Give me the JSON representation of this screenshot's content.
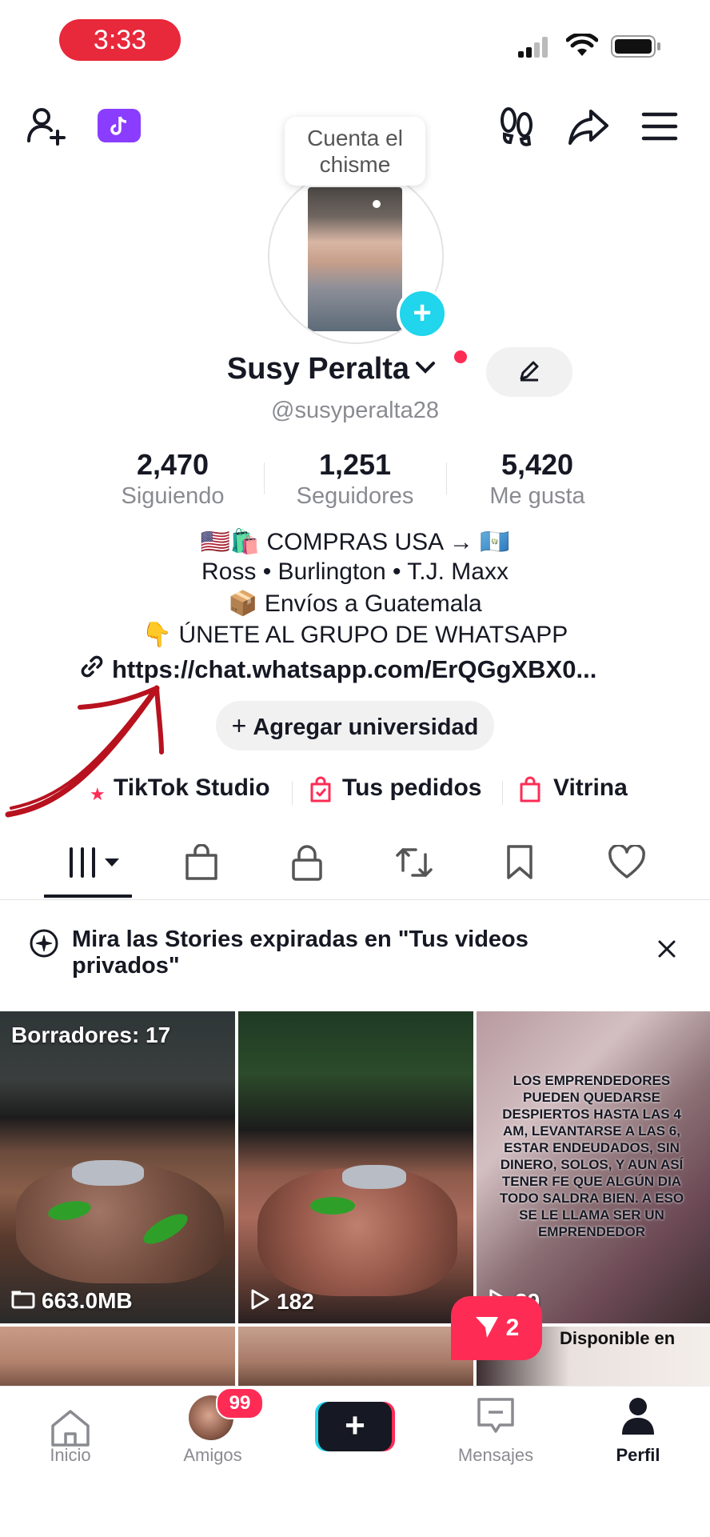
{
  "status_bar": {
    "time": "3:33"
  },
  "tooltip": {
    "text": "Cuenta el chisme"
  },
  "profile": {
    "name": "Susy Peralta",
    "handle": "@susyperalta28",
    "stats": [
      {
        "value": "2,470",
        "label": "Siguiendo"
      },
      {
        "value": "1,251",
        "label": "Seguidores"
      },
      {
        "value": "5,420",
        "label": "Me gusta"
      }
    ],
    "bio": [
      "🇺🇸🛍️ COMPRAS USA → 🇬🇹",
      "Ross • Burlington • T.J. Maxx",
      "📦 Envíos a Guatemala",
      "👇 ÚNETE AL GRUPO DE WHATSAPP"
    ],
    "link": "https://chat.whatsapp.com/ErQGgXBX0...",
    "add_university": "Agregar universidad"
  },
  "quick_links": [
    {
      "label": "TikTok Studio"
    },
    {
      "label": "Tus pedidos"
    },
    {
      "label": "Vitrina"
    }
  ],
  "notice": {
    "text": "Mira las Stories expiradas en \"Tus videos privados\""
  },
  "grid": {
    "drafts_label": "Borradores: 17",
    "drafts_size": "663.0MB",
    "video2_views": "182",
    "video3_overlay": "LOS EMPRENDEDORES PUEDEN QUEDARSE DESPIERTOS HASTA LAS 4 AM, LEVANTARSE A LAS 6, ESTAR ENDEUDADOS, SIN DINERO, SOLOS, Y AUN ASÍ TENER FE QUE ALGÚN DIA TODO SALDRA BIEN. A ESO SE LE LLAMA SER UN EMPRENDEDOR",
    "video3_views": "29",
    "available_text": "Disponible en",
    "share_count": "2"
  },
  "bottom_nav": {
    "items": [
      {
        "label": "Inicio"
      },
      {
        "label": "Amigos"
      },
      {
        "label": "Mensajes"
      },
      {
        "label": "Perfil"
      }
    ],
    "friends_badge": "99"
  },
  "colors": {
    "accent": "#fe2c55",
    "teal": "#20d5ec",
    "brand_purple": "#8b3dff"
  }
}
